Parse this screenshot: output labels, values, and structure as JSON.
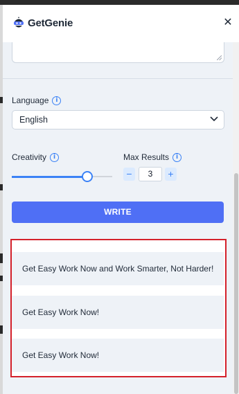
{
  "header": {
    "app_name": "GetGenie",
    "logo_icon": "genie-logo-icon",
    "close_label": "✕"
  },
  "language": {
    "label": "Language",
    "value": "English"
  },
  "creativity": {
    "label": "Creativity",
    "level_fraction": 0.75
  },
  "max_results": {
    "label": "Max Results",
    "value": "3",
    "decrement": "−",
    "increment": "+"
  },
  "write_button": {
    "label": "WRITE"
  },
  "results": [
    "Get Easy Work Now and Work Smarter, Not Harder!",
    "Get Easy Work Now!",
    "Get Easy Work Now!"
  ],
  "colors": {
    "accent": "#4f6ff5",
    "highlight_border": "#d4202a",
    "panel_bg": "#eef2f7"
  }
}
